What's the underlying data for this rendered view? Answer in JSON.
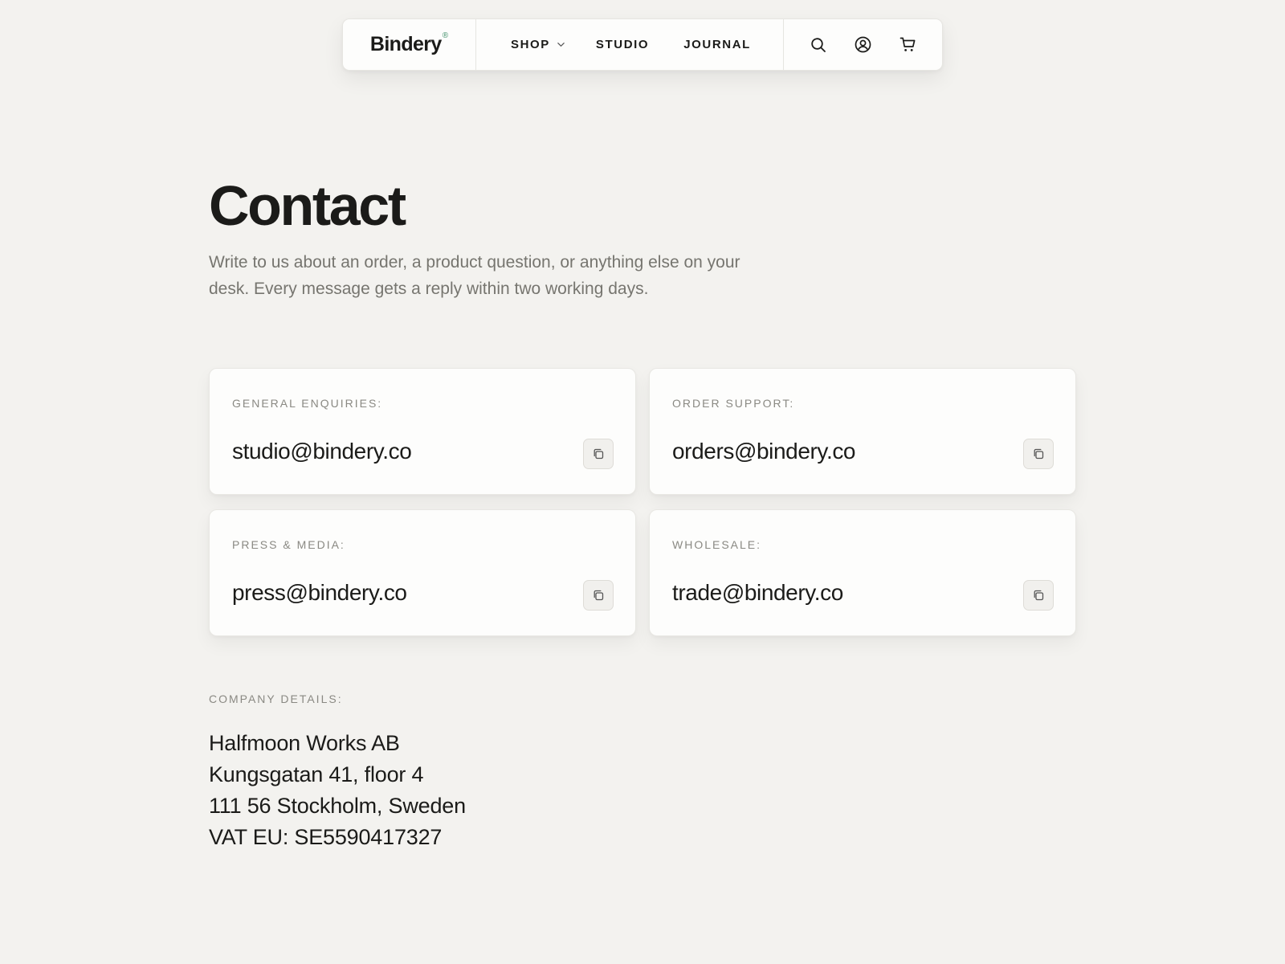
{
  "nav": {
    "brand": "Bindery",
    "brand_mark": "®",
    "links": [
      "SHOP",
      "STUDIO",
      "JOURNAL"
    ],
    "icons": [
      "search-icon",
      "account-icon",
      "cart-icon"
    ]
  },
  "page": {
    "title": "Contact",
    "subtitle": "Write to us about an order, a product question, or anything else on your desk. Every message gets a reply within two working days."
  },
  "contacts": [
    {
      "label": "GENERAL ENQUIRIES:",
      "email": "studio@bindery.co"
    },
    {
      "label": "ORDER SUPPORT:",
      "email": "orders@bindery.co"
    },
    {
      "label": "PRESS & MEDIA:",
      "email": "press@bindery.co"
    },
    {
      "label": "WHOLESALE:",
      "email": "trade@bindery.co"
    }
  ],
  "company": {
    "label": "COMPANY DETAILS:",
    "lines": [
      "Halfmoon Works AB",
      "Kungsgatan 41, floor 4",
      "111 56 Stockholm, Sweden",
      "VAT EU: SE5590417327"
    ]
  },
  "colors": {
    "background": "#f3f2ef",
    "card": "#fdfdfc",
    "text": "#1b1b19",
    "muted": "#76756f",
    "brand_accent": "#3f8f68"
  }
}
